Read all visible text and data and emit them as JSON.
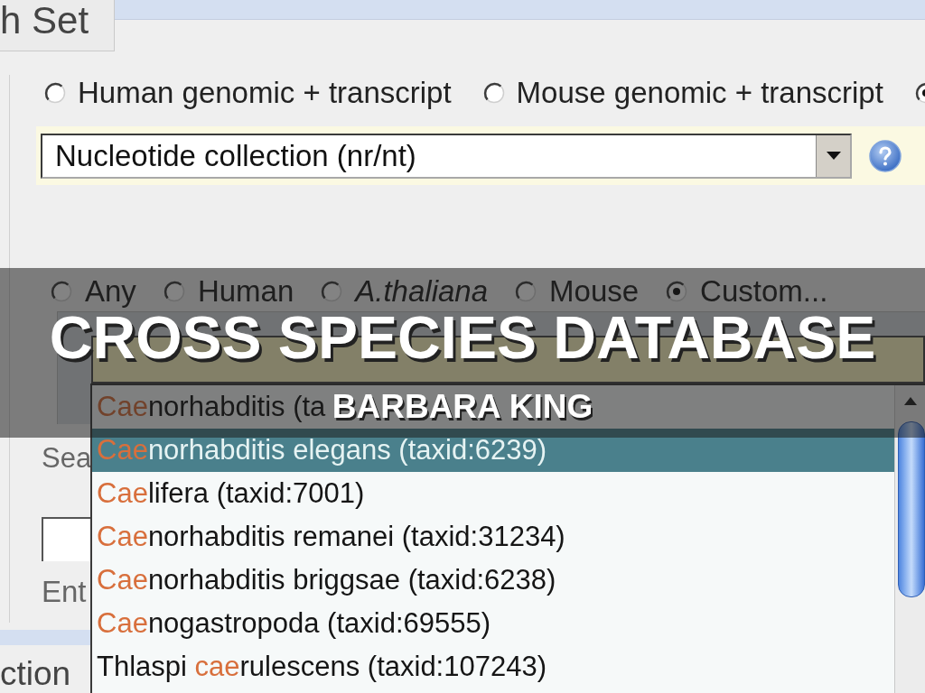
{
  "slide": {
    "title": "CROSS SPECIES DATABASE",
    "subtitle": "BARBARA KING"
  },
  "tab": {
    "label": "h Set"
  },
  "database_options": [
    {
      "label": "Human genomic + transcript",
      "selected": false
    },
    {
      "label": "Mouse genomic + transcript",
      "selected": false
    },
    {
      "selected": true
    }
  ],
  "database_select": {
    "value": "Nucleotide collection (nr/nt)"
  },
  "organism_options": [
    {
      "label": "Any",
      "italic": false,
      "selected": false
    },
    {
      "label": "Human",
      "italic": false,
      "selected": false
    },
    {
      "label": "A.thaliana",
      "italic": true,
      "selected": false
    },
    {
      "label": "Mouse",
      "italic": false,
      "selected": false
    },
    {
      "label": "Custom...",
      "italic": false,
      "selected": true
    }
  ],
  "suggestions": [
    {
      "match": "Cae",
      "suffix": "norhabditis (ta",
      "selected": false
    },
    {
      "match": "Cae",
      "suffix": "norhabditis elegans (taxid:6239)",
      "selected": true
    },
    {
      "match": "Cae",
      "suffix": "lifera (taxid:7001)",
      "selected": false
    },
    {
      "match": "Cae",
      "suffix": "norhabditis remanei (taxid:31234)",
      "selected": false
    },
    {
      "match": "Cae",
      "suffix": "norhabditis briggsae (taxid:6238)",
      "selected": false
    },
    {
      "match": "Cae",
      "suffix": "nogastropoda (taxid:69555)",
      "selected": false
    },
    {
      "prefix": "Thlaspi ",
      "match": "cae",
      "suffix": "rulescens (taxid:107243)",
      "selected": false
    }
  ],
  "search_label": "Sea",
  "hint_text": "Ent",
  "section_title": "ction"
}
